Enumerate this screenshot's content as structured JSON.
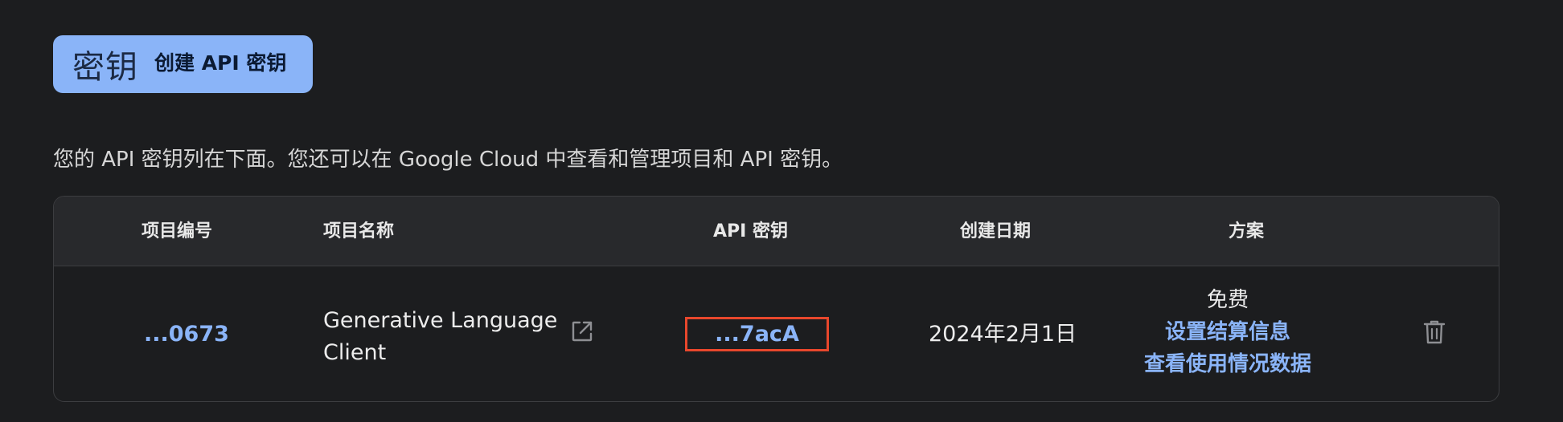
{
  "create_button": {
    "key_text": "密钥",
    "label": "创建 API 密钥"
  },
  "description": "您的 API 密钥列在下面。您还可以在 Google Cloud 中查看和管理项目和 API 密钥。",
  "table": {
    "headers": {
      "project_number": "项目编号",
      "project_name": "项目名称",
      "api_key": "API 密钥",
      "created_date": "创建日期",
      "plan": "方案"
    },
    "rows": [
      {
        "project_number": "...0673",
        "project_name": "Generative Language Client",
        "api_key": "...7acA",
        "created_date": "2024年2月1日",
        "plan": "免费",
        "billing_link": "设置结算信息",
        "usage_link": "查看使用情况数据"
      }
    ]
  },
  "icons": {
    "open_external": "open-in-new-icon",
    "delete": "trash-icon"
  },
  "colors": {
    "background": "#1c1d1f",
    "accent": "#8ab4f8",
    "highlight_border": "#e8472c"
  }
}
